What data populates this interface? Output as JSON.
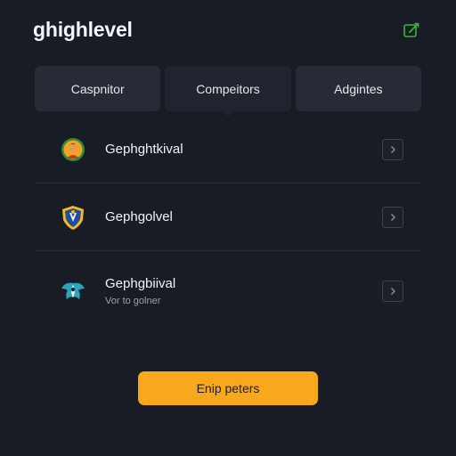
{
  "header": {
    "title": "ghighlevel",
    "edit_icon": "edit-square-icon",
    "accent_color": "#3cb043"
  },
  "tabs": [
    {
      "label": "Caspnitor",
      "active": false
    },
    {
      "label": "Compeitors",
      "active": true
    },
    {
      "label": "Adgintes",
      "active": false
    }
  ],
  "list": {
    "items": [
      {
        "title": "Gephghtkival",
        "subtitle": "",
        "avatar_icon": "portrait-avatar-icon"
      },
      {
        "title": "Gephgolvel",
        "subtitle": "",
        "avatar_icon": "shield-crest-icon"
      },
      {
        "title": "Gephgbiival",
        "subtitle": "Vor to golner",
        "avatar_icon": "winged-emblem-icon"
      }
    ],
    "chevron_icon": "chevron-right-icon"
  },
  "primary_action": {
    "label": "Enip peters",
    "color": "#f8a81b"
  }
}
